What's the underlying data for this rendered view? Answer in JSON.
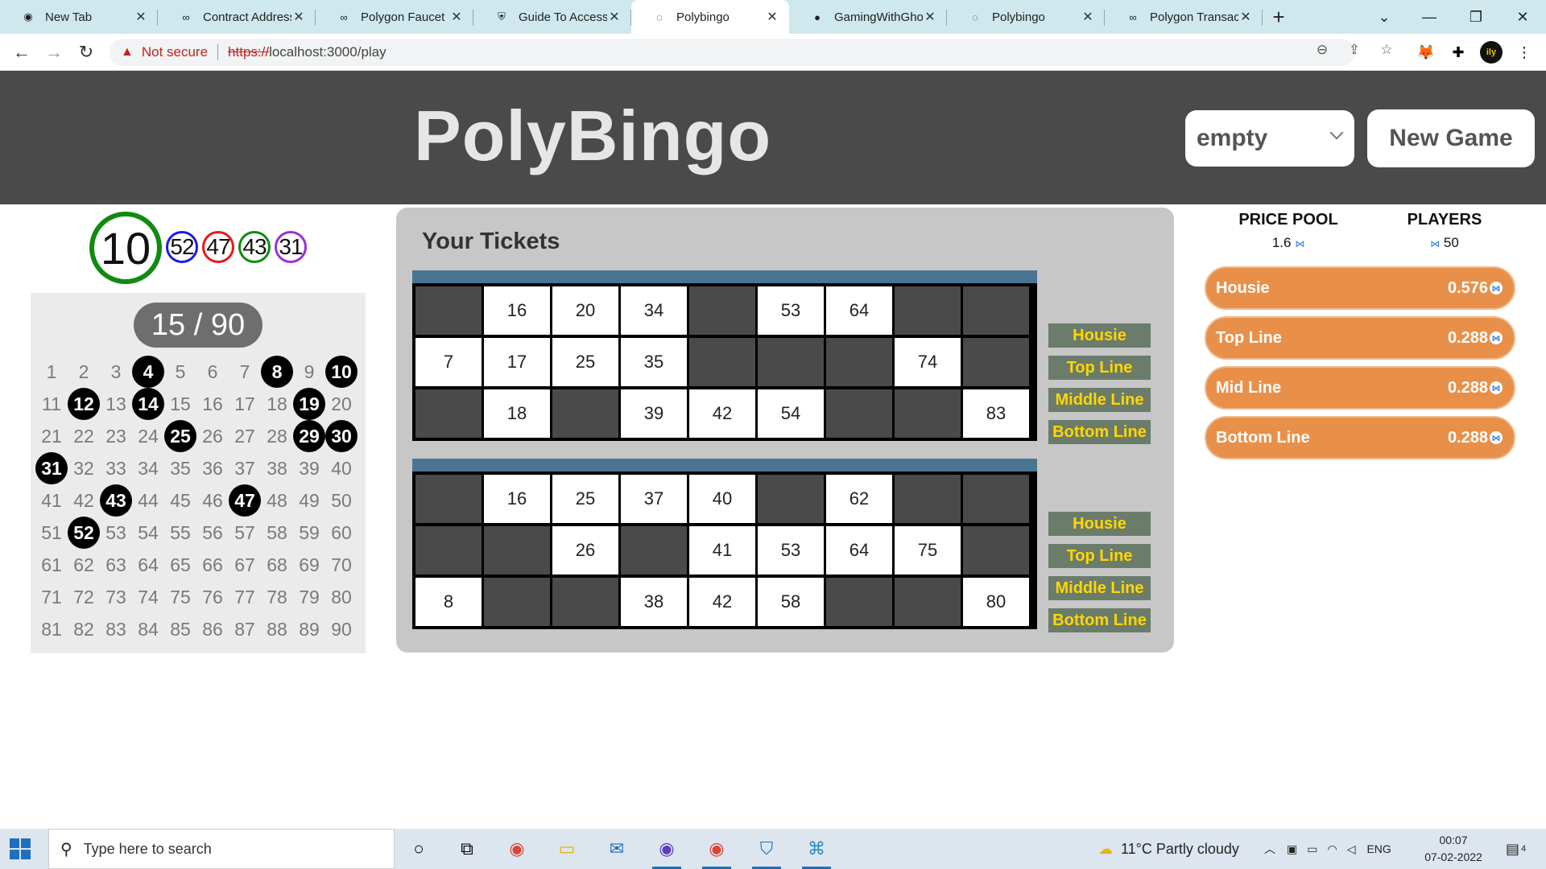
{
  "browser": {
    "tabs": [
      {
        "label": "New Tab",
        "icon": "chrome-icon",
        "active": false
      },
      {
        "label": "Contract Address",
        "icon": "polygon-icon",
        "active": false
      },
      {
        "label": "Polygon Faucet",
        "icon": "polygon-icon",
        "active": false
      },
      {
        "label": "Guide To Accessing",
        "icon": "shield-icon",
        "active": false
      },
      {
        "label": "Polybingo",
        "icon": "globe-icon",
        "active": true
      },
      {
        "label": "GamingWithGhost",
        "icon": "github-icon",
        "active": false
      },
      {
        "label": "Polybingo",
        "icon": "globe-icon",
        "active": false
      },
      {
        "label": "Polygon Transaction",
        "icon": "polygon-icon",
        "active": false
      }
    ],
    "security_label": "Not secure",
    "url_scheme": "https://",
    "url_rest": "localhost:3000/play"
  },
  "header": {
    "title": "PolyBingo",
    "game_select_value": "empty",
    "new_game_label": "New Game"
  },
  "calls": {
    "current": "10",
    "previous": [
      {
        "value": "52",
        "color": "#1a1ae6"
      },
      {
        "value": "47",
        "color": "#e61a1a"
      },
      {
        "value": "43",
        "color": "#118a11"
      },
      {
        "value": "31",
        "color": "#9b30d9"
      }
    ],
    "counter": "15 / 90",
    "called_numbers": [
      4,
      8,
      10,
      12,
      14,
      19,
      25,
      29,
      30,
      31,
      43,
      47,
      52
    ]
  },
  "tickets": {
    "title": "Your Tickets",
    "list": [
      {
        "rows": [
          [
            "",
            "16",
            "20",
            "34",
            "",
            "53",
            "64",
            "",
            ""
          ],
          [
            "7",
            "17",
            "25",
            "35",
            "",
            "",
            "",
            "74",
            ""
          ],
          [
            "",
            "18",
            "",
            "39",
            "42",
            "54",
            "",
            "",
            "83"
          ]
        ],
        "claims": [
          "Housie",
          "Top Line",
          "Middle Line",
          "Bottom Line"
        ]
      },
      {
        "rows": [
          [
            "",
            "16",
            "25",
            "37",
            "40",
            "",
            "62",
            "",
            ""
          ],
          [
            "",
            "",
            "26",
            "",
            "41",
            "53",
            "64",
            "75",
            ""
          ],
          [
            "8",
            "",
            "",
            "38",
            "42",
            "58",
            "",
            "",
            "80"
          ]
        ],
        "claims": [
          "Housie",
          "Top Line",
          "Middle Line",
          "Bottom Line"
        ]
      }
    ]
  },
  "stats": {
    "price_pool_label": "PRICE POOL",
    "price_pool_value": "1.6",
    "players_label": "PLAYERS",
    "players_value": "50"
  },
  "prizes": [
    {
      "name": "Housie",
      "amount": "0.576"
    },
    {
      "name": "Top Line",
      "amount": "0.288"
    },
    {
      "name": "Mid Line",
      "amount": "0.288"
    },
    {
      "name": "Bottom Line",
      "amount": "0.288"
    }
  ],
  "taskbar": {
    "search_placeholder": "Type here to search",
    "weather": "11°C  Partly cloudy",
    "language": "ENG",
    "time": "00:07",
    "date": "07-02-2022",
    "notification_count": "4"
  }
}
